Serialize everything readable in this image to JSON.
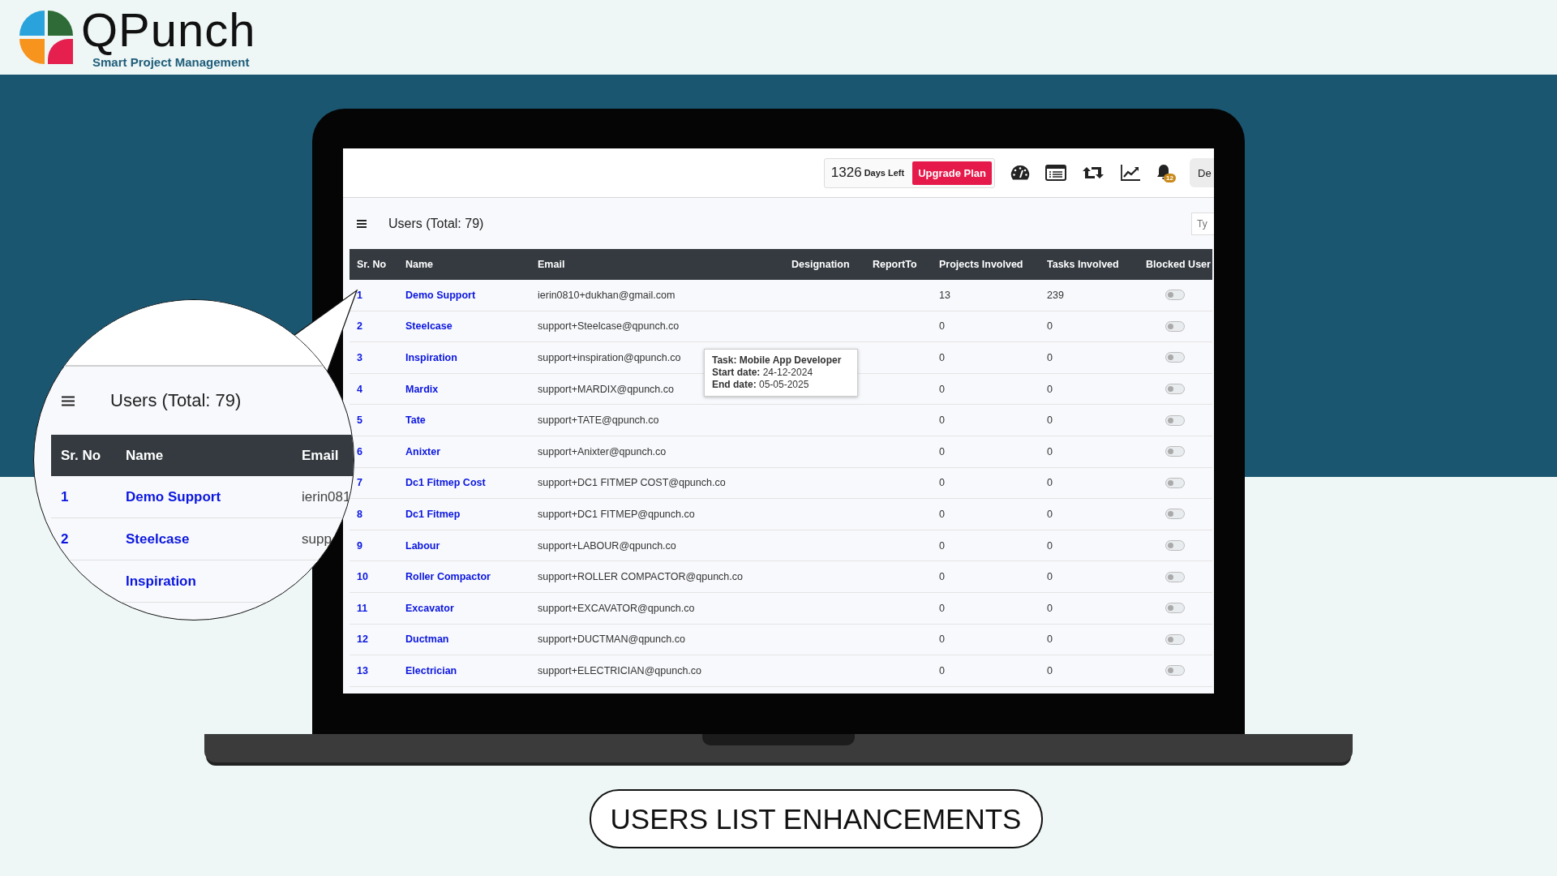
{
  "brand": {
    "name": "QPunch",
    "tagline": "Smart Project Management"
  },
  "topbar": {
    "days": "1326",
    "days_label": "Days Left",
    "upgrade": "Upgrade Plan",
    "notifications": "12",
    "user_button": "De"
  },
  "page": {
    "title": "Users (Total: 79)",
    "search": {
      "placeholder": "Ty"
    }
  },
  "table": {
    "columns": [
      "Sr. No",
      "Name",
      "Email",
      "Designation",
      "ReportTo",
      "Projects Involved",
      "Tasks Involved",
      "Blocked User"
    ],
    "rows": [
      {
        "sr": "1",
        "name": "Demo Support",
        "email": "ierin0810+dukhan@gmail.com",
        "projects": "13",
        "tasks": "239",
        "blocked": false
      },
      {
        "sr": "2",
        "name": "Steelcase",
        "email": "support+Steelcase@qpunch.co",
        "projects": "0",
        "tasks": "0",
        "blocked": false
      },
      {
        "sr": "3",
        "name": "Inspiration",
        "email": "support+inspiration@qpunch.co",
        "projects": "0",
        "tasks": "0",
        "blocked": false
      },
      {
        "sr": "4",
        "name": "Mardix",
        "email": "support+MARDIX@qpunch.co",
        "projects": "0",
        "tasks": "0",
        "blocked": false
      },
      {
        "sr": "5",
        "name": "Tate",
        "email": "support+TATE@qpunch.co",
        "projects": "0",
        "tasks": "0",
        "blocked": false
      },
      {
        "sr": "6",
        "name": "Anixter",
        "email": "support+Anixter@qpunch.co",
        "projects": "0",
        "tasks": "0",
        "blocked": false
      },
      {
        "sr": "7",
        "name": "Dc1 Fitmep Cost",
        "email": "support+DC1 FITMEP COST@qpunch.co",
        "projects": "0",
        "tasks": "0",
        "blocked": false
      },
      {
        "sr": "8",
        "name": "Dc1 Fitmep",
        "email": "support+DC1 FITMEP@qpunch.co",
        "projects": "0",
        "tasks": "0",
        "blocked": false
      },
      {
        "sr": "9",
        "name": "Labour",
        "email": "support+LABOUR@qpunch.co",
        "projects": "0",
        "tasks": "0",
        "blocked": false
      },
      {
        "sr": "10",
        "name": "Roller Compactor",
        "email": "support+ROLLER COMPACTOR@qpunch.co",
        "projects": "0",
        "tasks": "0",
        "blocked": false
      },
      {
        "sr": "11",
        "name": "Excavator",
        "email": "support+EXCAVATOR@qpunch.co",
        "projects": "0",
        "tasks": "0",
        "blocked": false
      },
      {
        "sr": "12",
        "name": "Ductman",
        "email": "support+DUCTMAN@qpunch.co",
        "projects": "0",
        "tasks": "0",
        "blocked": false
      },
      {
        "sr": "13",
        "name": "Electrician",
        "email": "support+ELECTRICIAN@qpunch.co",
        "projects": "0",
        "tasks": "0",
        "blocked": false
      }
    ]
  },
  "tooltip": {
    "title": "Task: Mobile App Developer",
    "lines": [
      "**Start date:** 24-12-2024",
      "**End date:** 05-05-2025"
    ]
  },
  "magnifier": {
    "title": "Users (Total: 79)",
    "columns": [
      "Sr. No",
      "Name",
      "Email"
    ],
    "rows": [
      {
        "sr": "1",
        "name": "Demo Support",
        "email": "ierin081"
      },
      {
        "sr": "2",
        "name": "Steelcase",
        "email": "supp"
      },
      {
        "name": "Inspiration"
      }
    ]
  },
  "banner": {
    "label": "USERS LIST ENHANCEMENTS"
  }
}
